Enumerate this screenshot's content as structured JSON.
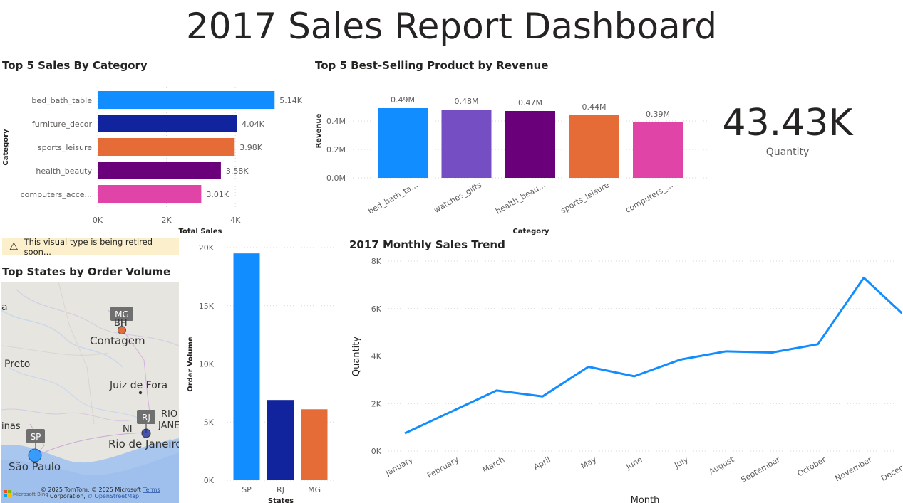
{
  "dashboard": {
    "title": "2017 Sales Report Dashboard",
    "kpi": {
      "value": "43.43K",
      "label": "Quantity"
    },
    "warning": {
      "icon": "warning-triangle-icon",
      "text": "This visual type is being retired soon..."
    },
    "map": {
      "title": "Top States by Order Volume",
      "places": [
        {
          "name": "MG",
          "kind": "badge"
        },
        {
          "name": "BH",
          "kind": "city"
        },
        {
          "name": "Contagem",
          "kind": "city"
        },
        {
          "name": "Preto",
          "kind": "city"
        },
        {
          "name": "Juiz de Fora",
          "kind": "city"
        },
        {
          "name": "RJ",
          "kind": "badge"
        },
        {
          "name": "RIO",
          "kind": "city"
        },
        {
          "name": "JANE",
          "kind": "city"
        },
        {
          "name": "NI",
          "kind": "city"
        },
        {
          "name": "Rio de Janeiro",
          "kind": "city"
        },
        {
          "name": "inas",
          "kind": "city"
        },
        {
          "name": "SP",
          "kind": "badge"
        },
        {
          "name": "São Paulo",
          "kind": "city"
        },
        {
          "name": "a",
          "kind": "city"
        }
      ],
      "attribution": "© 2025 TomTom, © 2025 Microsoft Corporation, © OpenStreetMap",
      "attribution_line1": "© 2025 TomTom, © 2025 Microsoft",
      "attribution_line2a": "Corporation,",
      "attribution_line2b": "© OpenStreetMap",
      "terms": "Terms",
      "logo": "Microsoft Bing",
      "colors": {
        "SP": "#118DFF",
        "RJ": "#12239E",
        "MG": "#E66C37"
      }
    }
  },
  "chart_data": [
    {
      "id": "category",
      "type": "bar",
      "orientation": "horizontal",
      "title": "Top 5 Sales By Category",
      "categories": [
        "bed_bath_table",
        "furniture_decor",
        "sports_leisure",
        "health_beauty",
        "computers_acce..."
      ],
      "values": [
        5140,
        4040,
        3980,
        3580,
        3010
      ],
      "data_labels": [
        "5.14K",
        "4.04K",
        "3.98K",
        "3.58K",
        "3.01K"
      ],
      "colors": [
        "#118DFF",
        "#12239E",
        "#E66C37",
        "#6B007B",
        "#E044A7"
      ],
      "xlabel": "Total Sales",
      "ylabel": "Category",
      "xlim": [
        0,
        5300
      ],
      "ticks": [
        0,
        2000,
        4000
      ],
      "tick_labels": [
        "0K",
        "2K",
        "4K"
      ],
      "grid": true
    },
    {
      "id": "product",
      "type": "bar",
      "title": "Top 5 Best-Selling Product by Revenue",
      "categories": [
        "bed_bath_ta...",
        "watches_gifts",
        "health_beau...",
        "sports_leisure",
        "computers_..."
      ],
      "values": [
        490000,
        480000,
        470000,
        440000,
        390000
      ],
      "data_labels": [
        "0.49M",
        "0.48M",
        "0.47M",
        "0.44M",
        "0.39M"
      ],
      "colors": [
        "#118DFF",
        "#744EC2",
        "#6B007B",
        "#E66C37",
        "#E044A7"
      ],
      "xlabel": "Category",
      "ylabel": "Revenue",
      "ylim": [
        0,
        500000
      ],
      "ticks": [
        0,
        200000,
        400000
      ],
      "tick_labels": [
        "0.0M",
        "0.2M",
        "0.4M"
      ],
      "grid": true
    },
    {
      "id": "states",
      "type": "bar",
      "categories": [
        "SP",
        "RJ",
        "MG"
      ],
      "values": [
        19500,
        6900,
        6100
      ],
      "colors": [
        "#118DFF",
        "#12239E",
        "#E66C37"
      ],
      "xlabel": "States",
      "ylabel": "Order Volume",
      "ylim": [
        0,
        20000
      ],
      "ticks": [
        0,
        5000,
        10000,
        15000,
        20000
      ],
      "tick_labels": [
        "0K",
        "5K",
        "10K",
        "15K",
        "20K"
      ],
      "grid": true
    },
    {
      "id": "monthly",
      "type": "line",
      "title": "2017 Monthly Sales Trend",
      "x": [
        "January",
        "February",
        "March",
        "April",
        "May",
        "June",
        "July",
        "August",
        "September",
        "October",
        "November",
        "December"
      ],
      "values": [
        750,
        1650,
        2550,
        2300,
        3550,
        3150,
        3850,
        4200,
        4150,
        4500,
        7300,
        5500
      ],
      "color": "#118DFF",
      "xlabel": "Month",
      "ylabel": "Quantity",
      "ylim": [
        0,
        8000
      ],
      "ticks": [
        0,
        2000,
        4000,
        6000,
        8000
      ],
      "tick_labels": [
        "0K",
        "2K",
        "4K",
        "6K",
        "8K"
      ],
      "grid": true
    }
  ]
}
